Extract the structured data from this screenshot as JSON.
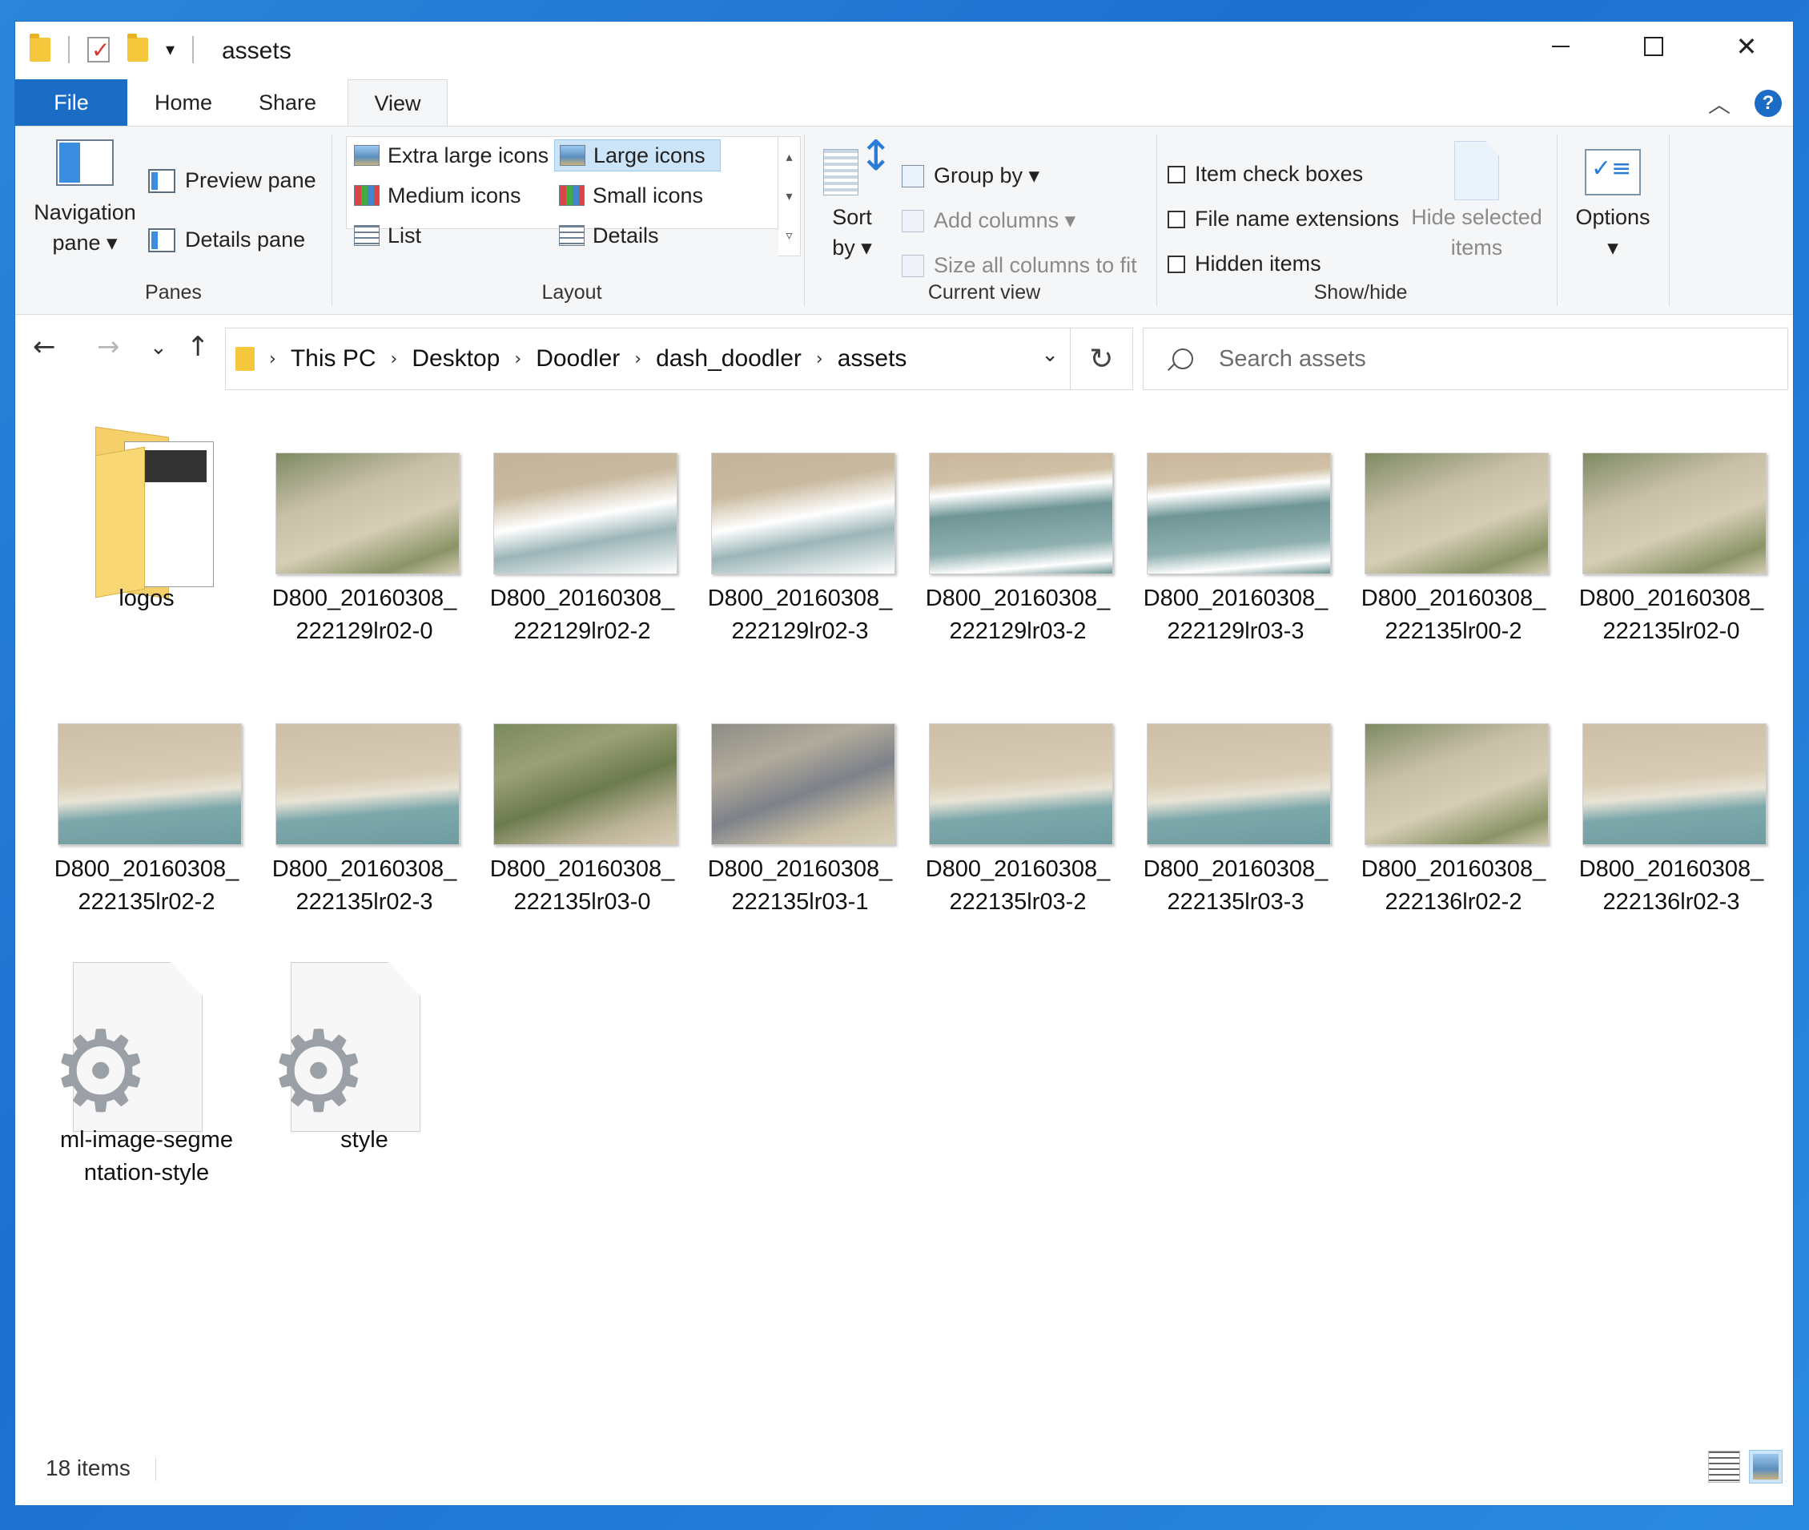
{
  "window": {
    "title": "assets"
  },
  "titlebar": {
    "minimize": "—",
    "maximize": "",
    "close": "✕"
  },
  "tabs": {
    "file": "File",
    "home": "Home",
    "share": "Share",
    "view": "View",
    "help": "?"
  },
  "ribbon": {
    "panes": {
      "label": "Panes",
      "navigation_pane_line1": "Navigation",
      "navigation_pane_line2": "pane ▾",
      "preview_pane": "Preview pane",
      "details_pane": "Details pane"
    },
    "layout": {
      "label": "Layout",
      "extra_large_icons": "Extra large icons",
      "large_icons": "Large icons",
      "medium_icons": "Medium icons",
      "small_icons": "Small icons",
      "list": "List",
      "details": "Details",
      "selected": "Large icons"
    },
    "current_view": {
      "label": "Current view",
      "sort_by_line1": "Sort",
      "sort_by_line2": "by ▾",
      "group_by": "Group by ▾",
      "add_columns": "Add columns ▾",
      "size_all_columns": "Size all columns to fit"
    },
    "show_hide": {
      "label": "Show/hide",
      "item_check_boxes": "Item check boxes",
      "file_name_extensions": "File name extensions",
      "hidden_items": "Hidden items",
      "hide_selected_line1": "Hide selected",
      "hide_selected_line2": "items"
    },
    "options": {
      "label_line1": "Options",
      "label_line2": "▾"
    }
  },
  "address": {
    "breadcrumbs": [
      "This PC",
      "Desktop",
      "Doodler",
      "dash_doodler",
      "assets"
    ],
    "search_placeholder": "Search assets"
  },
  "items": [
    {
      "type": "folder",
      "line1": "logos",
      "line2": ""
    },
    {
      "type": "image",
      "line1": "D800_20160308_",
      "line2": "222129lr02-0",
      "scene": "dune"
    },
    {
      "type": "image",
      "line1": "D800_20160308_",
      "line2": "222129lr02-2",
      "scene": "surf"
    },
    {
      "type": "image",
      "line1": "D800_20160308_",
      "line2": "222129lr02-3",
      "scene": "surf"
    },
    {
      "type": "image",
      "line1": "D800_20160308_",
      "line2": "222129lr03-2",
      "scene": "ocean"
    },
    {
      "type": "image",
      "line1": "D800_20160308_",
      "line2": "222129lr03-3",
      "scene": "ocean"
    },
    {
      "type": "image",
      "line1": "D800_20160308_",
      "line2": "222135lr00-2",
      "scene": "dune"
    },
    {
      "type": "image",
      "line1": "D800_20160308_",
      "line2": "222135lr02-0",
      "scene": "dune"
    },
    {
      "type": "image",
      "line1": "D800_20160308_",
      "line2": "222135lr02-2",
      "scene": "beach"
    },
    {
      "type": "image",
      "line1": "D800_20160308_",
      "line2": "222135lr02-3",
      "scene": "beach"
    },
    {
      "type": "image",
      "line1": "D800_20160308_",
      "line2": "222135lr03-0",
      "scene": "vegetation"
    },
    {
      "type": "image",
      "line1": "D800_20160308_",
      "line2": "222135lr03-1",
      "scene": "houses"
    },
    {
      "type": "image",
      "line1": "D800_20160308_",
      "line2": "222135lr03-2",
      "scene": "beach"
    },
    {
      "type": "image",
      "line1": "D800_20160308_",
      "line2": "222135lr03-3",
      "scene": "beach"
    },
    {
      "type": "image",
      "line1": "D800_20160308_",
      "line2": "222136lr02-2",
      "scene": "dune"
    },
    {
      "type": "image",
      "line1": "D800_20160308_",
      "line2": "222136lr02-3",
      "scene": "beach"
    },
    {
      "type": "css",
      "line1": "ml-image-segme",
      "line2": "ntation-style"
    },
    {
      "type": "css",
      "line1": "style",
      "line2": ""
    }
  ],
  "status": {
    "count": "18 items"
  },
  "colors": {
    "accent": "#1a6cc4",
    "selected_bg": "#cce4f7"
  }
}
